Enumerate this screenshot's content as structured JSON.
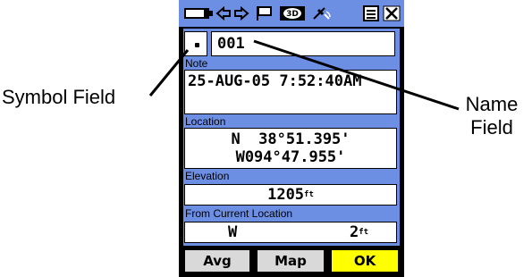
{
  "callouts": {
    "symbol_field": "Symbol Field",
    "name_field_line1": "Name",
    "name_field_line2": "Field"
  },
  "waypoint": {
    "name": "001",
    "note_label": "Note",
    "note": "25-AUG-05 7:52:40AM",
    "location_label": "Location",
    "latitude": "N  38°51.395'",
    "longitude": "W094°47.955'",
    "elevation_label": "Elevation",
    "elevation": "1205",
    "elevation_unit": "ft",
    "from_label": "From Current Location",
    "bearing": "W",
    "distance": "2",
    "distance_unit": "ft"
  },
  "softkeys": {
    "avg": "Avg",
    "map": "Map",
    "ok": "OK"
  },
  "colors": {
    "panel": "#6d8fe3",
    "ok_button": "#ffff00",
    "softkey": "#d9d9d9"
  },
  "status_icons": [
    "battery-icon",
    "backlight-icon",
    "flag-icon",
    "3d-fix-icon",
    "satellite-icon",
    "menu-icon",
    "close-icon"
  ]
}
